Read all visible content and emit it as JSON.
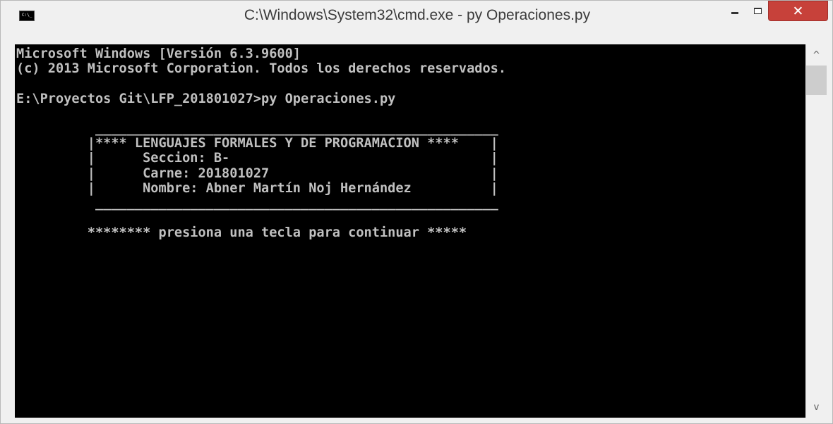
{
  "window": {
    "title": "C:\\Windows\\System32\\cmd.exe - py  Operaciones.py",
    "icon": "cmd-icon",
    "icon_glyph": "C:\\_",
    "close_glyph": "✕"
  },
  "console": {
    "lines": [
      "Microsoft Windows [Versión 6.3.9600]",
      "(c) 2013 Microsoft Corporation. Todos los derechos reservados.",
      "",
      "E:\\Proyectos Git\\LFP_201801027>py Operaciones.py",
      "",
      "          ___________________________________________________",
      "         |**** LENGUAJES FORMALES Y DE PROGRAMACION ****    |",
      "         |      Seccion: B-                                 |",
      "         |      Carne: 201801027                            |",
      "         |      Nombre: Abner Martín Noj Hernández          |",
      "          ___________________________________________________",
      "",
      "         ******** presiona una tecla para continuar *****"
    ]
  },
  "scrollbar": {
    "up_glyph": "^",
    "down_glyph": "v"
  }
}
